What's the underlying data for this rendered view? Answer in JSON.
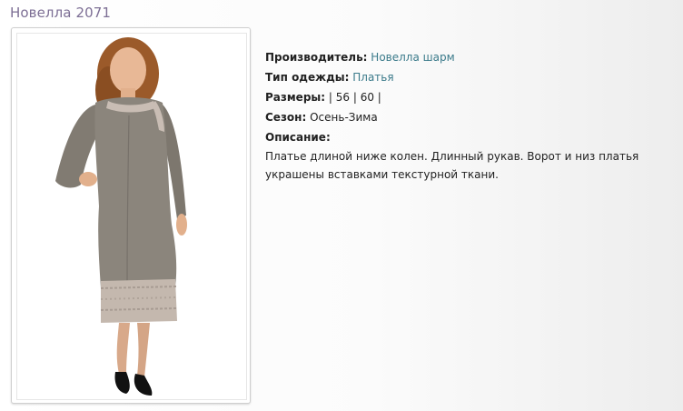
{
  "product": {
    "title": "Новелла 2071",
    "image_alt": "Платье - Новелла 2071"
  },
  "details": {
    "manufacturer_label": "Производитель:",
    "manufacturer_value": "Новелла шарм",
    "type_label": "Тип одежды:",
    "type_value": "Платья",
    "sizes_label": "Размеры:",
    "sizes_value": "| 56 | 60 |",
    "season_label": "Сезон:",
    "season_value": "Осень-Зима",
    "description_label": "Описание:",
    "description_text": "Платье длиной ниже колен. Длинный рукав. Ворот и низ платья украшены вставками текстурной ткани."
  },
  "colors": {
    "title": "#7d6f95",
    "link": "#3a7a8a",
    "dress": "#8b857c",
    "trim": "#c9bdb4"
  }
}
